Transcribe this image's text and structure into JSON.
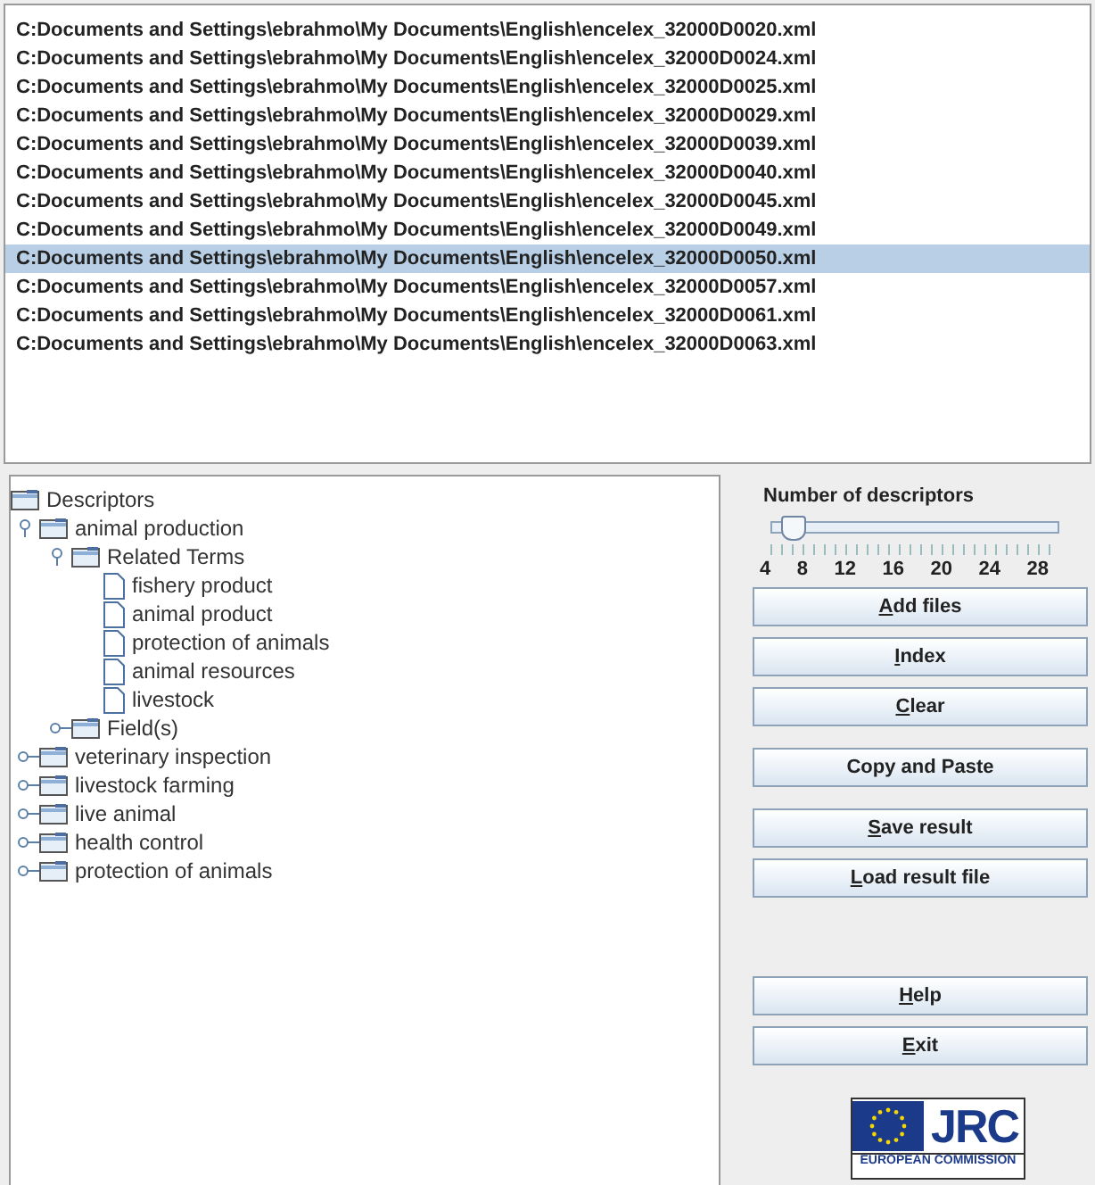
{
  "files": [
    {
      "path": "C:Documents and Settings\\ebrahmo\\My Documents\\English\\encelex_32000D0020.xml",
      "selected": false
    },
    {
      "path": "C:Documents and Settings\\ebrahmo\\My Documents\\English\\encelex_32000D0024.xml",
      "selected": false
    },
    {
      "path": "C:Documents and Settings\\ebrahmo\\My Documents\\English\\encelex_32000D0025.xml",
      "selected": false
    },
    {
      "path": "C:Documents and Settings\\ebrahmo\\My Documents\\English\\encelex_32000D0029.xml",
      "selected": false
    },
    {
      "path": "C:Documents and Settings\\ebrahmo\\My Documents\\English\\encelex_32000D0039.xml",
      "selected": false
    },
    {
      "path": "C:Documents and Settings\\ebrahmo\\My Documents\\English\\encelex_32000D0040.xml",
      "selected": false
    },
    {
      "path": "C:Documents and Settings\\ebrahmo\\My Documents\\English\\encelex_32000D0045.xml",
      "selected": false
    },
    {
      "path": "C:Documents and Settings\\ebrahmo\\My Documents\\English\\encelex_32000D0049.xml",
      "selected": false
    },
    {
      "path": "C:Documents and Settings\\ebrahmo\\My Documents\\English\\encelex_32000D0050.xml",
      "selected": true
    },
    {
      "path": "C:Documents and Settings\\ebrahmo\\My Documents\\English\\encelex_32000D0057.xml",
      "selected": false
    },
    {
      "path": "C:Documents and Settings\\ebrahmo\\My Documents\\English\\encelex_32000D0061.xml",
      "selected": false
    },
    {
      "path": "C:Documents and Settings\\ebrahmo\\My Documents\\English\\encelex_32000D0063.xml",
      "selected": false
    }
  ],
  "tree": {
    "label": "Descriptors",
    "kind": "folder",
    "children": [
      {
        "label": "animal production",
        "kind": "folder",
        "expanded": true,
        "children": [
          {
            "label": "Related Terms",
            "kind": "folder",
            "expanded": true,
            "children": [
              {
                "label": "fishery product",
                "kind": "document"
              },
              {
                "label": "animal product",
                "kind": "document"
              },
              {
                "label": "protection of animals",
                "kind": "document"
              },
              {
                "label": "animal resources",
                "kind": "document"
              },
              {
                "label": "livestock",
                "kind": "document"
              }
            ]
          },
          {
            "label": "Field(s)",
            "kind": "folder",
            "expanded": false
          }
        ]
      },
      {
        "label": "veterinary inspection",
        "kind": "folder",
        "expanded": false
      },
      {
        "label": "livestock farming",
        "kind": "folder",
        "expanded": false
      },
      {
        "label": "live animal",
        "kind": "folder",
        "expanded": false
      },
      {
        "label": "health control",
        "kind": "folder",
        "expanded": false
      },
      {
        "label": "protection of animals",
        "kind": "folder",
        "expanded": false
      }
    ]
  },
  "slider": {
    "label": "Number of descriptors",
    "level": 0.07,
    "tick_labels": [
      "4",
      "8",
      "12",
      "16",
      "20",
      "24",
      "28"
    ]
  },
  "button_groups": [
    [
      {
        "label": "Add files",
        "underline_first": true
      },
      {
        "label": "Index",
        "underline_first": true
      },
      {
        "label": "Clear",
        "underline_first": true
      }
    ],
    [
      {
        "label": "Copy and Paste",
        "underline_first": false
      }
    ],
    [
      {
        "label": "Save result",
        "underline_first": true
      },
      {
        "label": "Load result file",
        "underline_first": true
      }
    ],
    [
      {
        "label": "Help",
        "underline_first": true
      },
      {
        "label": "Exit",
        "underline_first": true
      }
    ]
  ],
  "logo": {
    "title": "JRC",
    "subtitle": "EUROPEAN COMMISSION"
  }
}
